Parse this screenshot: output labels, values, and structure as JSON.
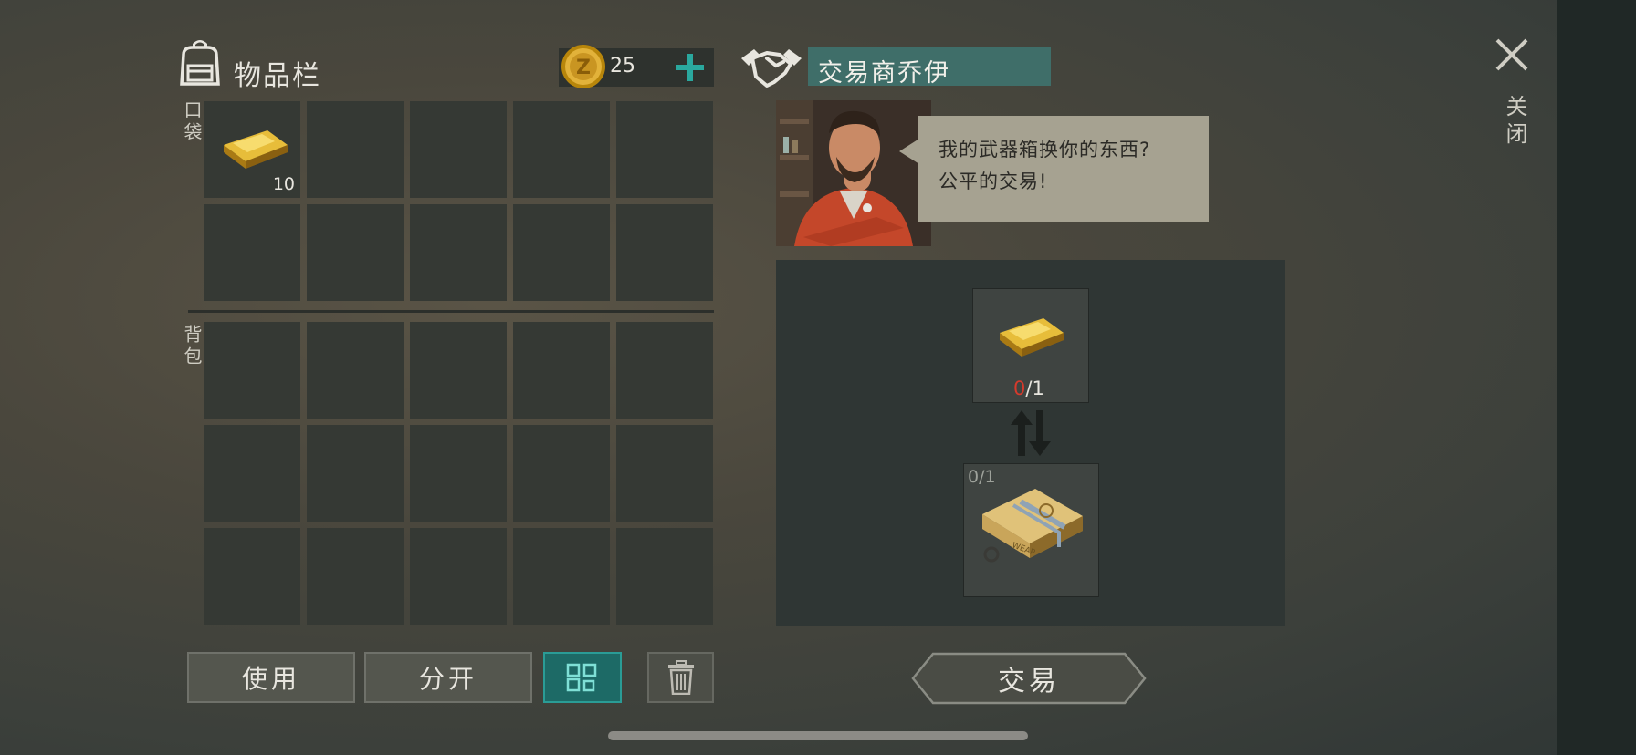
{
  "inventory": {
    "title": "物品栏",
    "coins": "25",
    "pocket_label": "口袋",
    "backpack_label": "背包",
    "pocket_slots": [
      {
        "item": "gold-bar",
        "quantity": "10"
      },
      {
        "item": "",
        "quantity": ""
      },
      {
        "item": "",
        "quantity": ""
      },
      {
        "item": "",
        "quantity": ""
      },
      {
        "item": "",
        "quantity": ""
      },
      {
        "item": "",
        "quantity": ""
      },
      {
        "item": "",
        "quantity": ""
      },
      {
        "item": "",
        "quantity": ""
      },
      {
        "item": "",
        "quantity": ""
      },
      {
        "item": "",
        "quantity": ""
      }
    ],
    "backpack_slot_count": 15
  },
  "actions": {
    "use_label": "使用",
    "split_label": "分开",
    "sort_icon": "grid-sort-icon",
    "trash_icon": "trash-icon"
  },
  "trader": {
    "name": "交易商乔伊",
    "speech_line1": "我的武器箱换你的东西?",
    "speech_line2": "公平的交易!",
    "required": {
      "item": "gold-bar",
      "have": "0",
      "need": "/1"
    },
    "offer": {
      "item": "weapon-crate",
      "count": "0/1"
    },
    "trade_label": "交易"
  },
  "close": {
    "label": "关闭"
  },
  "colors": {
    "accent": "#1d6a66",
    "name_box": "#3f6e69",
    "missing": "#d63a2c"
  }
}
